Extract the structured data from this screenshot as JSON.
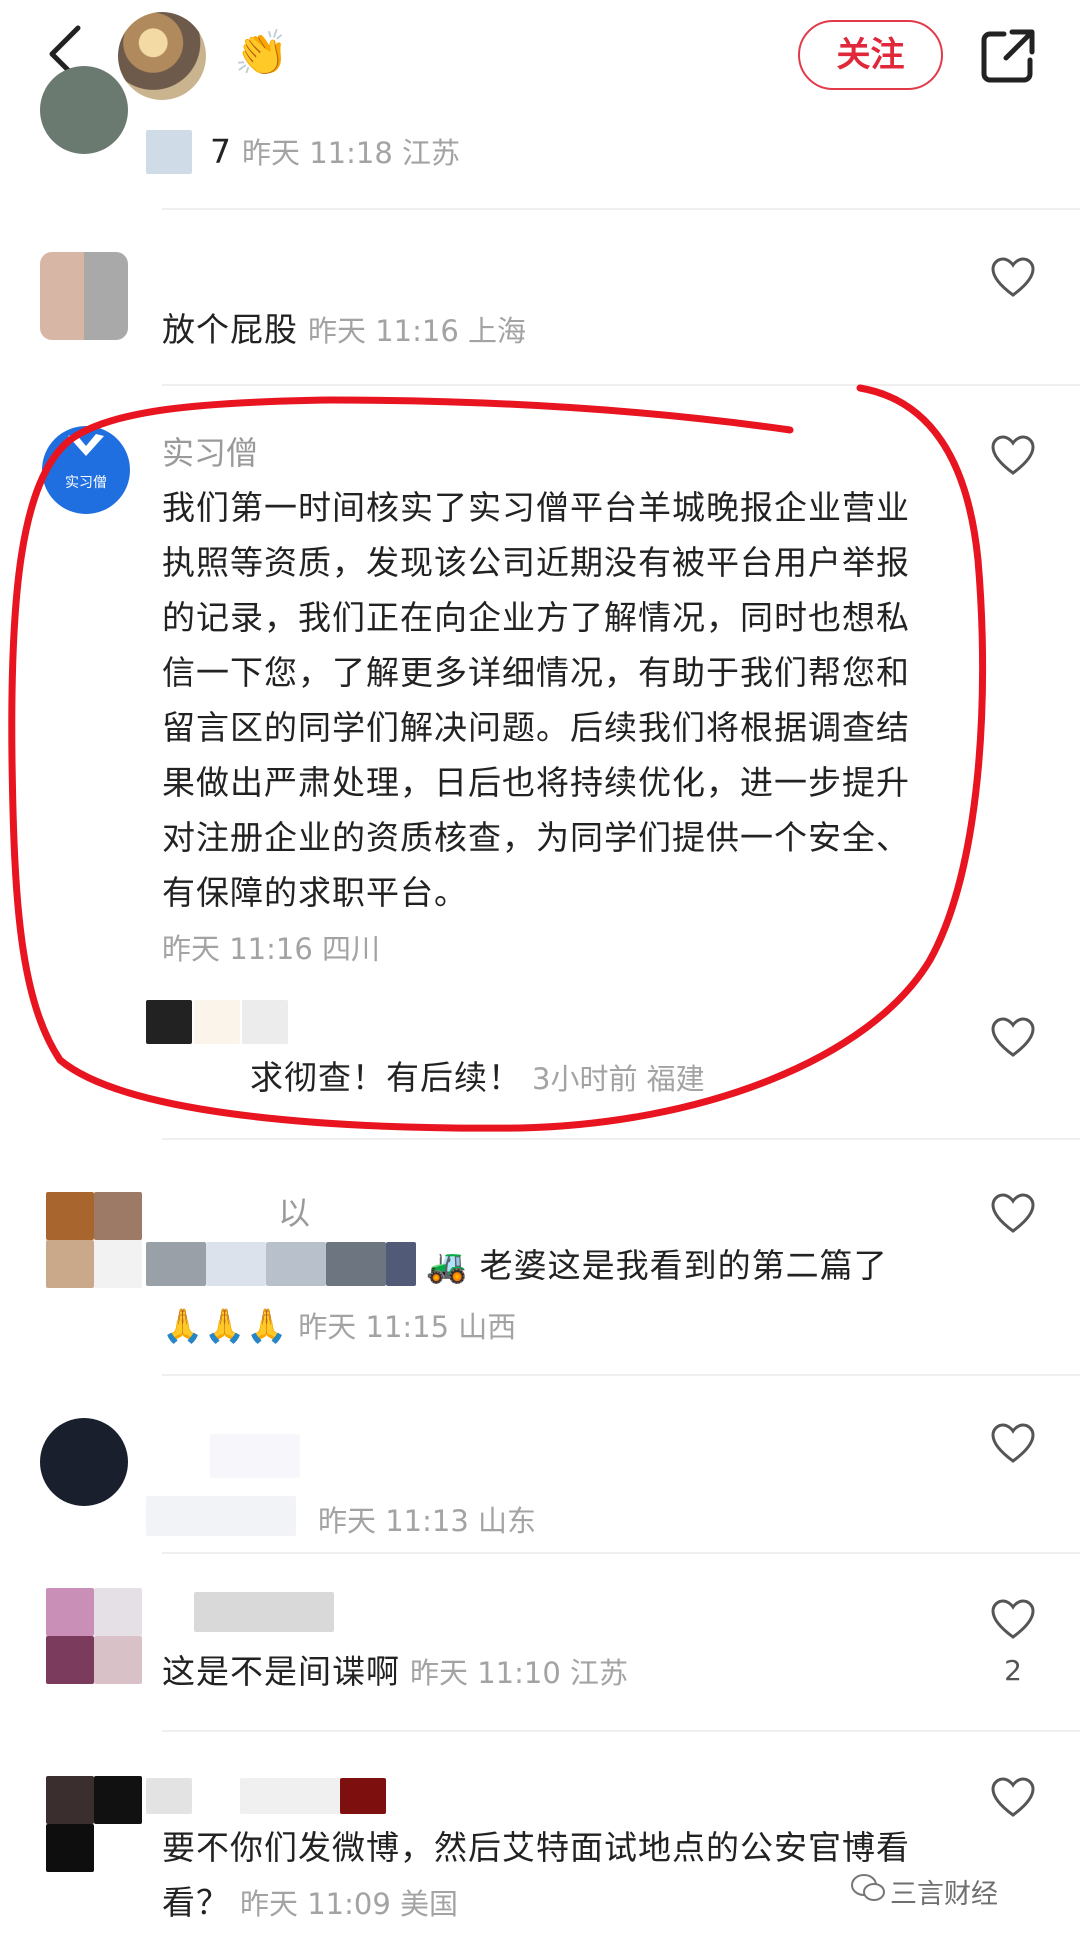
{
  "header": {
    "emoji": "👏",
    "follow_label": "关注"
  },
  "comments": [
    {
      "username": "",
      "text": "7",
      "meta": "昨天 11:18 江苏"
    },
    {
      "username": "",
      "text": "放个屁股",
      "meta": "昨天 11:16 上海"
    },
    {
      "username": "实习僧",
      "text": "我们第一时间核实了实习僧平台羊城晚报企业营业执照等资质，发现该公司近期没有被平台用户举报的记录，我们正在向企业方了解情况，同时也想私信一下您，了解更多详细情况，有助于我们帮您和留言区的同学们解决问题。后续我们将根据调查结果做出严肃处理，日后也将持续优化，进一步提升对注册企业的资质核查，为同学们提供一个安全、有保障的求职平台。",
      "meta": "昨天 11:16 四川",
      "avatar_text": "实习僧"
    },
    {
      "username": "",
      "text": "求彻查！有后续！",
      "meta": "3小时前 福建"
    },
    {
      "username": "以",
      "text": "🚜 老婆这是我看到的第二篇了",
      "emojis": "🙏🙏🙏",
      "meta": "昨天 11:15 山西"
    },
    {
      "username": "",
      "text": "",
      "meta": "昨天 11:13 山东"
    },
    {
      "username": "",
      "text": "这是不是间谍啊",
      "meta": "昨天 11:10 江苏",
      "likes": "2"
    },
    {
      "username": "",
      "text": "要不你们发微博，然后艾特面试地点的公安官博看看？",
      "meta": "昨天 11:09 美国"
    }
  ],
  "watermark": "三言财经"
}
